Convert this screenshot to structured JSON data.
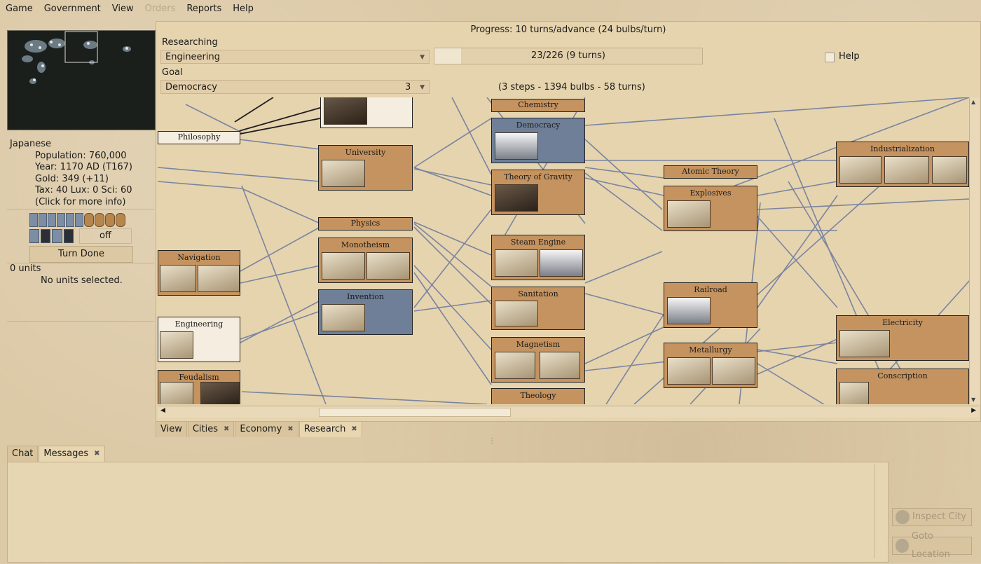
{
  "menubar": [
    "Game",
    "Government",
    "View",
    "Orders",
    "Reports",
    "Help"
  ],
  "menubar_disabled": "Orders",
  "info": {
    "nation": "Japanese",
    "population": "Population: 760,000",
    "year": "Year: 1170 AD (T167)",
    "gold": "Gold: 349 (+11)",
    "tax": "Tax: 40 Lux: 0 Sci: 60",
    "more": "(Click for more info)"
  },
  "controls": {
    "off_label": "off",
    "turn_done": "Turn Done"
  },
  "units": {
    "count": "0 units",
    "none": "No units selected."
  },
  "research": {
    "progress": "Progress: 10 turns/advance (24 bulbs/turn)",
    "researching_label": "Researching",
    "researching_value": "Engineering",
    "progress_bar": "23/226 (9 turns)",
    "progress_fraction": 0.1,
    "help_label": "Help",
    "goal_label": "Goal",
    "goal_value": "Democracy",
    "goal_steps": "3",
    "goal_summary": "(3 steps - 1394 bulbs - 58 turns)"
  },
  "techs": {
    "philosophy": "Philosophy",
    "university": "University",
    "physics": "Physics",
    "monotheism": "Monotheism",
    "invention": "Invention",
    "navigation": "Navigation",
    "engineering": "Engineering",
    "feudalism": "Feudalism",
    "chemistry": "Chemistry",
    "democracy": "Democracy",
    "gravity": "Theory of Gravity",
    "steam": "Steam Engine",
    "sanitation": "Sanitation",
    "magnetism": "Magnetism",
    "theology": "Theology",
    "atomic": "Atomic Theory",
    "explosives": "Explosives",
    "railroad": "Railroad",
    "metallurgy": "Metallurgy",
    "industrialization": "Industrialization",
    "electricity": "Electricity",
    "conscription": "Conscription"
  },
  "main_tabs": [
    "View",
    "Cities",
    "Economy",
    "Research"
  ],
  "bottom_tabs": [
    "Chat",
    "Messages"
  ],
  "buttons": {
    "inspect_city": "Inspect City",
    "goto_location": "Goto Location"
  },
  "colors": {
    "parchment": "#dcc9a6",
    "tech_known": "#c5935f",
    "tech_researching": "#6e7f97",
    "link_line": "#7a84a0"
  }
}
